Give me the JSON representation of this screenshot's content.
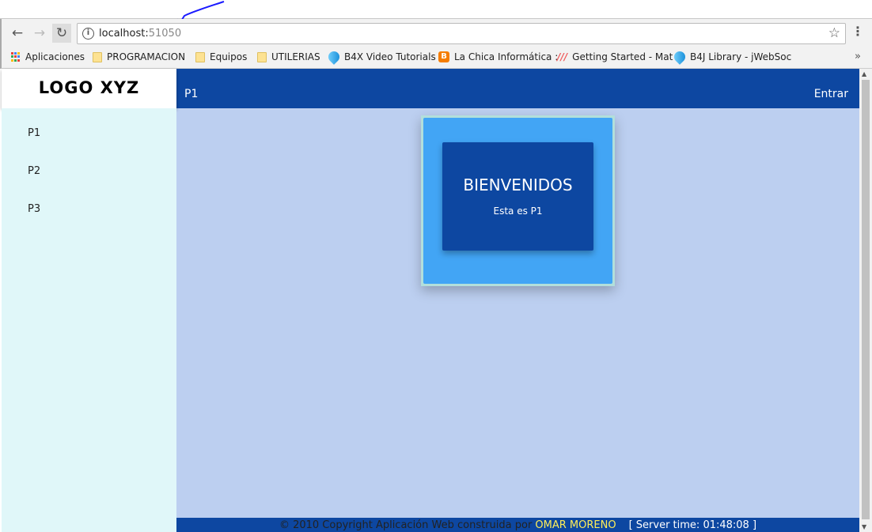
{
  "browser": {
    "url_host": "localhost:",
    "url_port": "51050",
    "bookmarks": [
      "Aplicaciones",
      "PROGRAMACION",
      "Equipos",
      "UTILERIAS",
      "B4X Video Tutorials",
      "La Chica Informática :",
      "Getting Started - Mat",
      "B4J Library - jWebSoc"
    ],
    "more": "»"
  },
  "header": {
    "logo": "LOGO XYZ",
    "title": "P1",
    "login": "Entrar"
  },
  "sidebar": {
    "items": [
      {
        "label": "P1"
      },
      {
        "label": "P2"
      },
      {
        "label": "P3"
      }
    ]
  },
  "card": {
    "title": "BIENVENIDOS",
    "subtitle": "Esta es P1"
  },
  "footer": {
    "text": "© 2010 Copyright Aplicación Web construida por ",
    "author": "OMAR MORENO",
    "server_time": "[ Server time: 01:48:08 ]"
  },
  "colors": {
    "primary": "#0d47a1",
    "card": "#42a5f5",
    "sidebar": "#e0f7f9",
    "content": "#bccff0"
  }
}
